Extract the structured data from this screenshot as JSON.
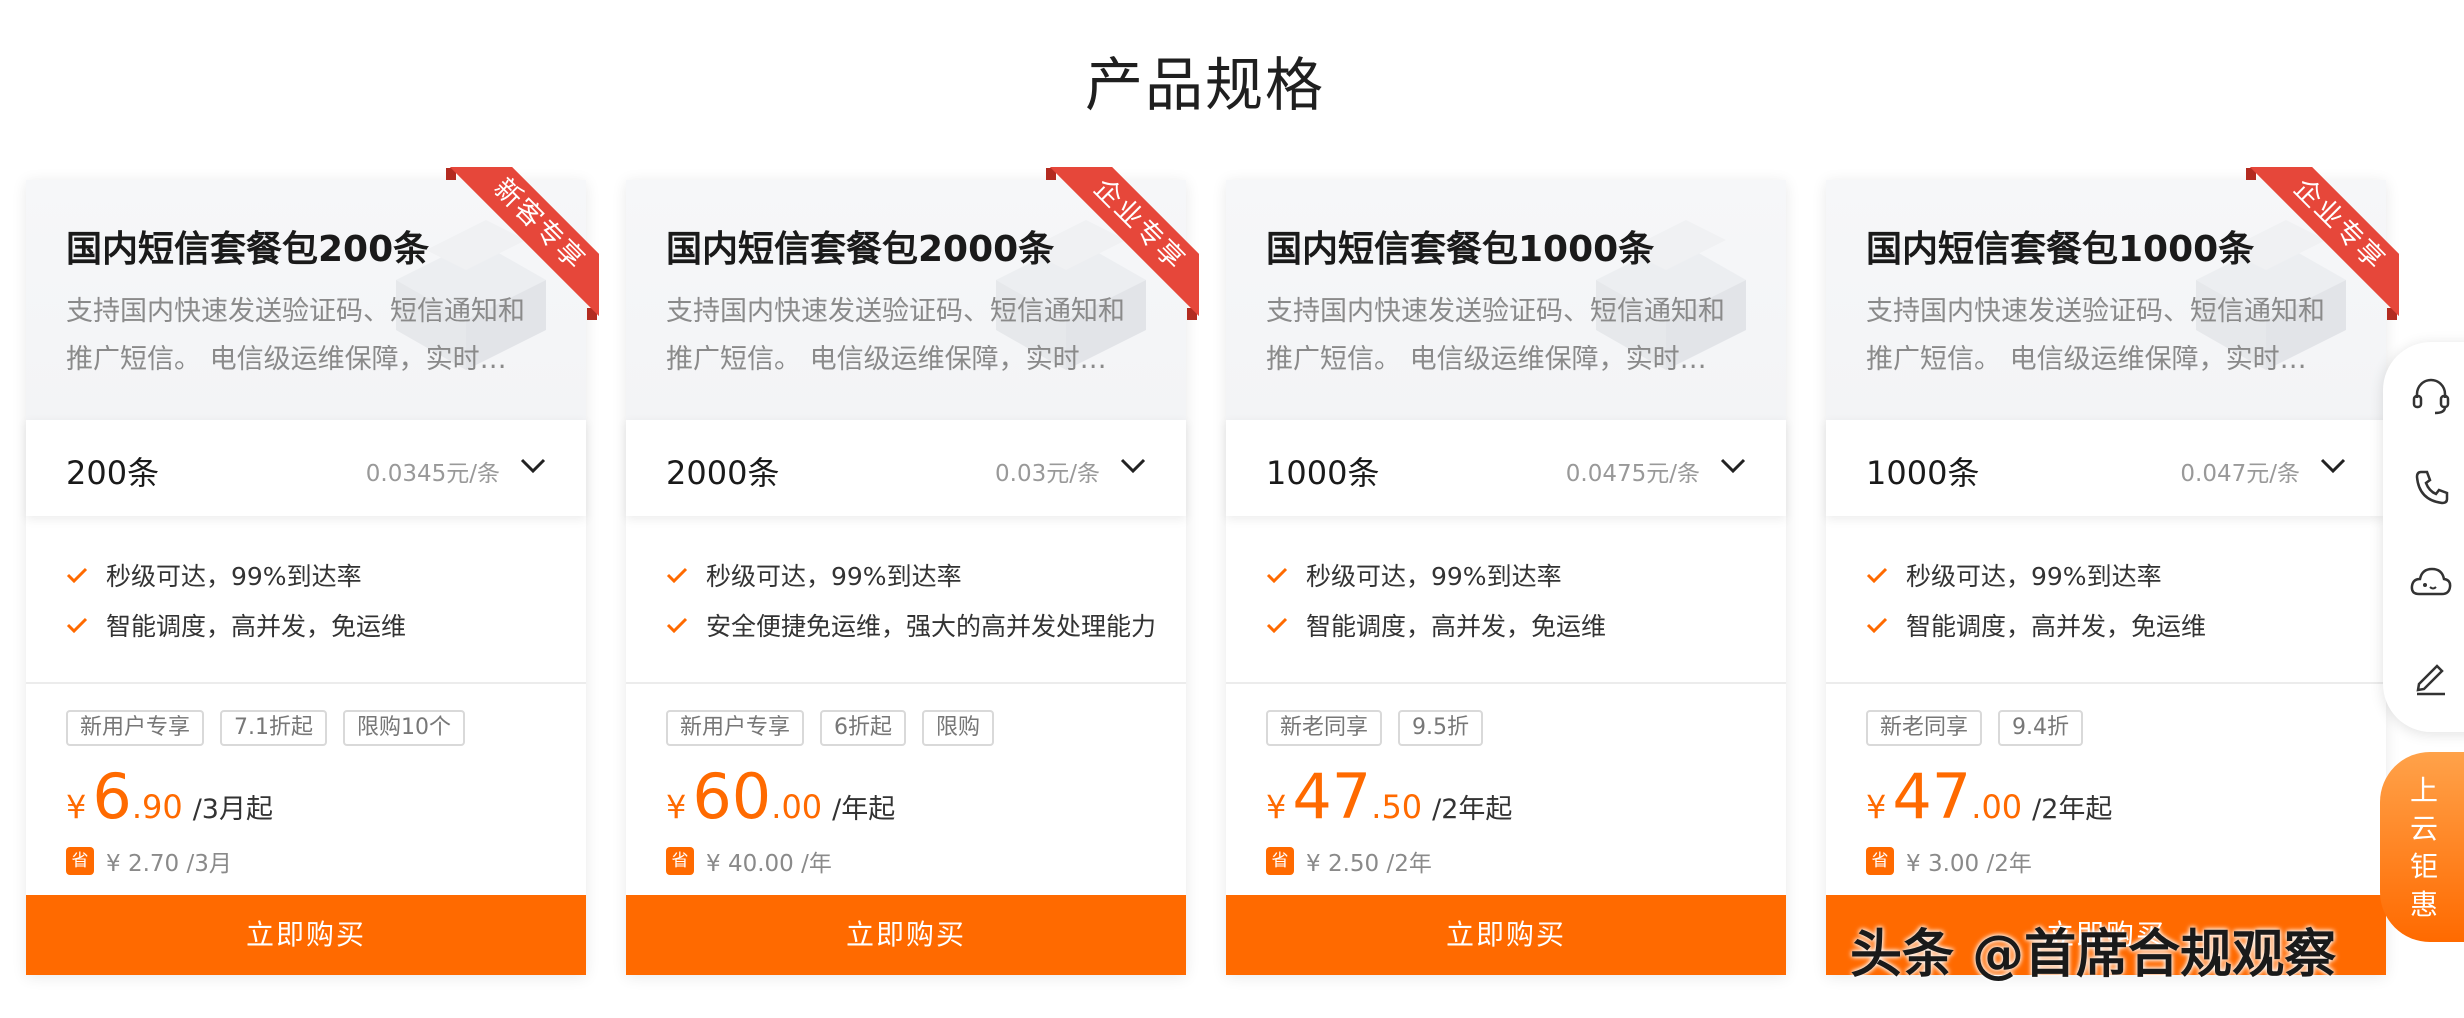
{
  "page": {
    "title": "产品规格"
  },
  "colors": {
    "accent": "#ff6a00",
    "ribbon": "#e6473a",
    "muted": "#8a8a8a"
  },
  "cards": [
    {
      "title": "国内短信套餐包200条",
      "ribbon": "新客专享",
      "description": "支持国内快速发送验证码、短信通知和推广短信。 电信级运维保障，实时…",
      "spec": {
        "count": "200条",
        "unit_price": "0.0345元/条"
      },
      "features": [
        "秒级可达，99%到达率",
        "智能调度，高并发，免运维"
      ],
      "tags": [
        "新用户专享",
        "7.1折起",
        "限购10个"
      ],
      "price": {
        "currency": "¥",
        "int": "6",
        "dec": ".90",
        "suffix": "/3月起"
      },
      "save": {
        "badge": "省",
        "text": "¥ 2.70 /3月"
      },
      "buy_label": "立即购买"
    },
    {
      "title": "国内短信套餐包2000条",
      "ribbon": "企业专享",
      "description": "支持国内快速发送验证码、短信通知和推广短信。 电信级运维保障，实时…",
      "spec": {
        "count": "2000条",
        "unit_price": "0.03元/条"
      },
      "features": [
        "秒级可达，99%到达率",
        "安全便捷免运维，强大的高并发处理能力"
      ],
      "tags": [
        "新用户专享",
        "6折起",
        "限购"
      ],
      "price": {
        "currency": "¥",
        "int": "60",
        "dec": ".00",
        "suffix": "/年起"
      },
      "save": {
        "badge": "省",
        "text": "¥ 40.00 /年"
      },
      "buy_label": "立即购买"
    },
    {
      "title": "国内短信套餐包1000条",
      "ribbon": "",
      "description": "支持国内快速发送验证码、短信通知和推广短信。 电信级运维保障，实时…",
      "spec": {
        "count": "1000条",
        "unit_price": "0.0475元/条"
      },
      "features": [
        "秒级可达，99%到达率",
        "智能调度，高并发，免运维"
      ],
      "tags": [
        "新老同享",
        "9.5折"
      ],
      "price": {
        "currency": "¥",
        "int": "47",
        "dec": ".50",
        "suffix": "/2年起"
      },
      "save": {
        "badge": "省",
        "text": "¥ 2.50 /2年"
      },
      "buy_label": "立即购买"
    },
    {
      "title": "国内短信套餐包1000条",
      "ribbon": "企业专享",
      "description": "支持国内快速发送验证码、短信通知和推广短信。 电信级运维保障，实时…",
      "spec": {
        "count": "1000条",
        "unit_price": "0.047元/条"
      },
      "features": [
        "秒级可达，99%到达率",
        "智能调度，高并发，免运维"
      ],
      "tags": [
        "新老同享",
        "9.4折"
      ],
      "price": {
        "currency": "¥",
        "int": "47",
        "dec": ".00",
        "suffix": "/2年起"
      },
      "save": {
        "badge": "省",
        "text": "¥ 3.00 /2年"
      },
      "buy_label": "立即购买"
    }
  ],
  "sidebar": {
    "icons": [
      "headset-icon",
      "phone-icon",
      "cloud-chat-icon",
      "edit-icon"
    ],
    "promo_label": "上云钜惠"
  },
  "watermark": "头条 @首席合规观察"
}
